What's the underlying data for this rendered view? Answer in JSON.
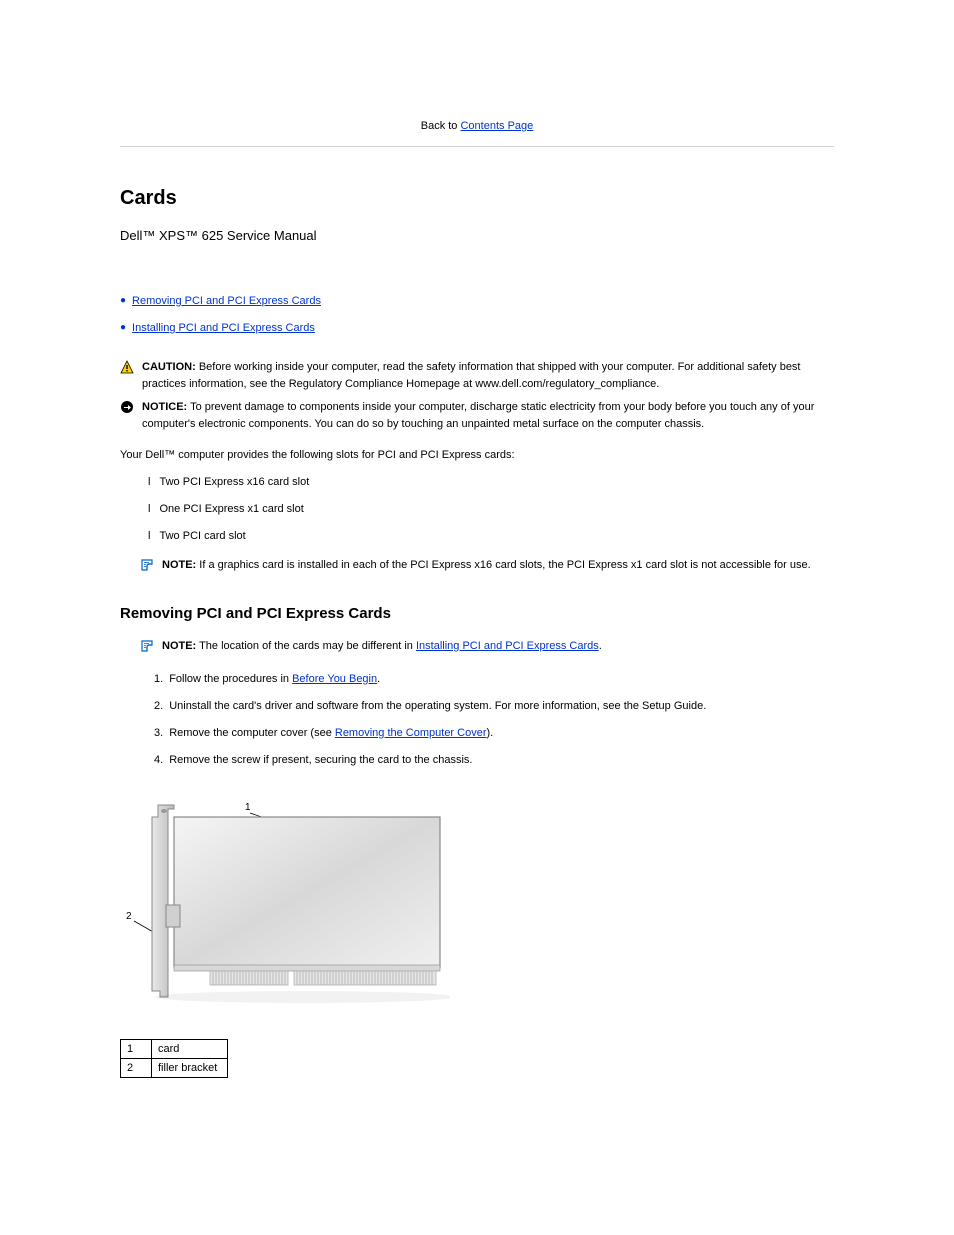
{
  "back_link": {
    "prefix": "Back to ",
    "label": "Contents Page"
  },
  "title": "Cards",
  "subtitle": "Dell™ XPS™ 625 Service Manual",
  "sections": {
    "removing": "Removing PCI and PCI Express Cards",
    "installing": "Installing PCI and PCI Express Cards"
  },
  "caution": {
    "label": "CAUTION:",
    "text": " Before working inside your computer, read the safety information that shipped with your computer. For additional safety best practices information, see the Regulatory Compliance Homepage at www.dell.com/regulatory_compliance."
  },
  "notice": {
    "label": "NOTICE:",
    "text": " To prevent damage to components inside your computer, discharge static electricity from your body before you touch any of your computer's electronic components. You can do so by touching an unpainted metal surface on the computer chassis."
  },
  "intro": "Your Dell™ computer provides the following slots for PCI and PCI Express cards:",
  "slots": [
    "Two PCI Express x16 card slot",
    "One PCI Express x1 card slot",
    "Two PCI card slot"
  ],
  "note": {
    "label": "NOTE:",
    "text": " If a graphics card is installed in each of the PCI Express x16 card slots, the PCI Express x1 card slot is not accessible for use."
  },
  "heading_removing": "Removing PCI and PCI Express Cards",
  "note2": {
    "label": "NOTE:",
    "text_before": " The location of the cards may be different in ",
    "link": "Installing PCI and PCI Express Cards",
    "text_after": "."
  },
  "steps": [
    {
      "num": "1.",
      "text": "Follow the procedures in ",
      "link": "Before You Begin",
      "after": "."
    },
    {
      "num": "2.",
      "text": "Uninstall the card's driver and software from the operating system. For more information, see the Setup Guide."
    },
    {
      "num": "3.",
      "text": "Remove the computer cover (see ",
      "link": "Removing the Computer Cover",
      "after": ")."
    },
    {
      "num": "4.",
      "text": "Remove the screw if present, securing the card to the chassis."
    }
  ],
  "figure": {
    "top_label": "1",
    "left_label": "2"
  },
  "legend": [
    {
      "num": "1",
      "text": "card"
    },
    {
      "num": "2",
      "text": "filler bracket"
    }
  ]
}
